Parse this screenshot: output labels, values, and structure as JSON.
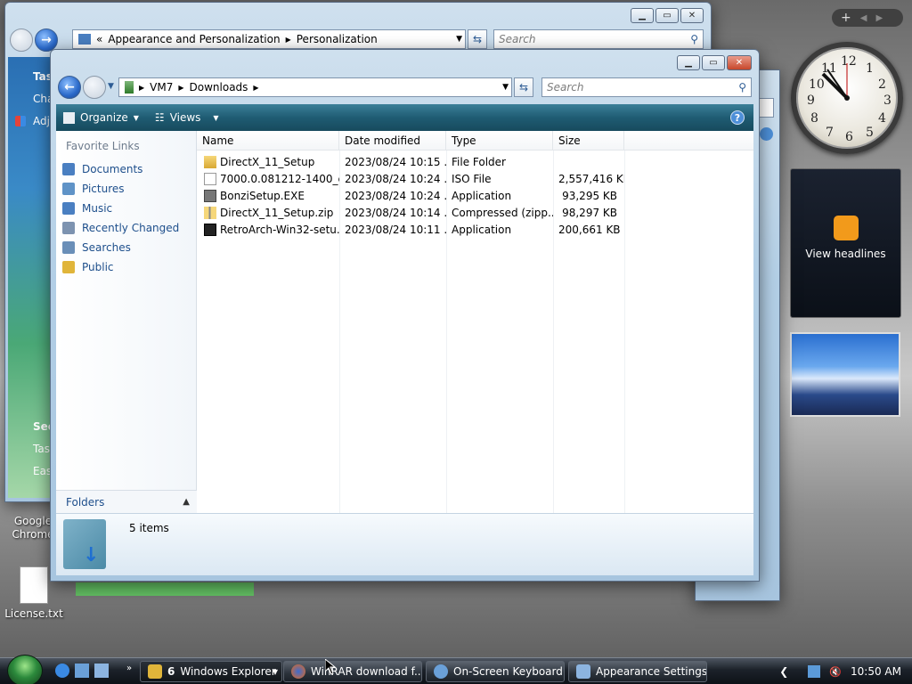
{
  "desktop": {
    "icons": [
      {
        "label": "Google Chrome"
      },
      {
        "label": "License.txt"
      }
    ]
  },
  "gadgets": {
    "clock_numbers": [
      "12",
      "1",
      "2",
      "3",
      "4",
      "5",
      "6",
      "7",
      "8",
      "9",
      "10",
      "11"
    ],
    "rss_label": "View headlines"
  },
  "back_window": {
    "address": [
      "Appearance and Personalization",
      "Personalization"
    ],
    "address_prefix": "«",
    "search_placeholder": "Search",
    "left_partial": [
      "Tas",
      "Cha",
      "Adj",
      "See",
      "Tas",
      "Eas"
    ]
  },
  "explorer": {
    "address": [
      "VM7",
      "Downloads"
    ],
    "search_placeholder": "Search",
    "toolbar": {
      "organize": "Organize",
      "views": "Views"
    },
    "favorite_links_title": "Favorite Links",
    "favorite_links": [
      {
        "label": "Documents",
        "color": "#4a7fc1"
      },
      {
        "label": "Pictures",
        "color": "#5f93c7"
      },
      {
        "label": "Music",
        "color": "#4a7fc1"
      },
      {
        "label": "Recently Changed",
        "color": "#7d93b0"
      },
      {
        "label": "Searches",
        "color": "#6a8fb8"
      },
      {
        "label": "Public",
        "color": "#e0b53a"
      }
    ],
    "folders_label": "Folders",
    "columns": [
      "Name",
      "Date modified",
      "Type",
      "Size"
    ],
    "files": [
      {
        "name": "DirectX_11_Setup",
        "date": "2023/08/24 10:15 ...",
        "type": "File Folder",
        "size": "",
        "icon": "folder-icon"
      },
      {
        "name": "7000.0.081212-1400_cli...",
        "date": "2023/08/24 10:24 ...",
        "type": "ISO File",
        "size": "2,557,416 KB",
        "icon": "iso-file-icon"
      },
      {
        "name": "BonziSetup.EXE",
        "date": "2023/08/24 10:24 ...",
        "type": "Application",
        "size": "93,295 KB",
        "icon": "exe-file-icon"
      },
      {
        "name": "DirectX_11_Setup.zip",
        "date": "2023/08/24 10:14 ...",
        "type": "Compressed (zipp...",
        "size": "98,297 KB",
        "icon": "zip-file-icon"
      },
      {
        "name": "RetroArch-Win32-setu...",
        "date": "2023/08/24 10:11 ...",
        "type": "Application",
        "size": "200,661 KB",
        "icon": "exe-file-icon"
      }
    ],
    "item_count": "5 items"
  },
  "taskbar": {
    "tasks": [
      {
        "count": "6",
        "label": "Windows Explorer"
      },
      {
        "label": "WinRAR download f..."
      },
      {
        "label": "On-Screen Keyboard"
      },
      {
        "label": "Appearance Settings"
      }
    ],
    "time": "10:50 AM"
  },
  "colors": {
    "accent": "#1e4f8c",
    "toolbar": "#1f5c73",
    "close_button": "#c7472b"
  }
}
